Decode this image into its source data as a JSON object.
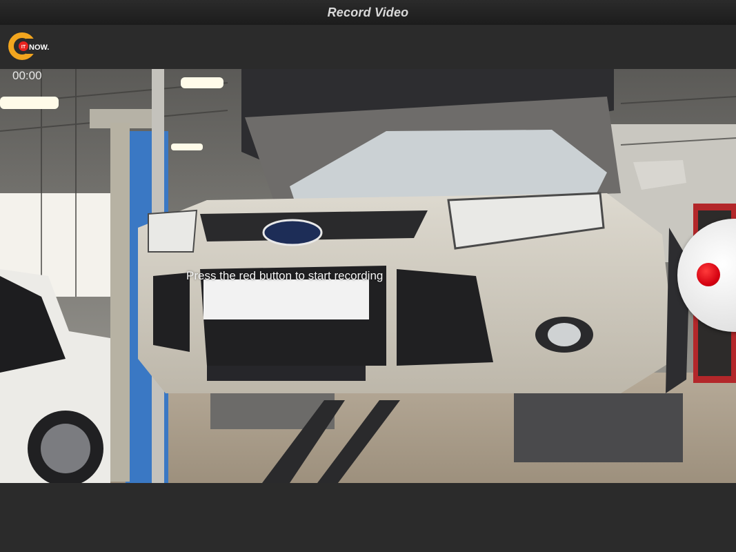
{
  "titlebar": {
    "title": "Record Video"
  },
  "logo": {
    "letter": "C",
    "badge": "IT",
    "word": "NOW."
  },
  "colors": {
    "logo_ring": "#f2a51e",
    "record_red": "#d40010",
    "bar_bg": "#2b2b2b"
  },
  "recorder": {
    "timer": "00:00",
    "hint": "Press the red button to start recording"
  },
  "icons": {
    "record": "record-icon"
  }
}
